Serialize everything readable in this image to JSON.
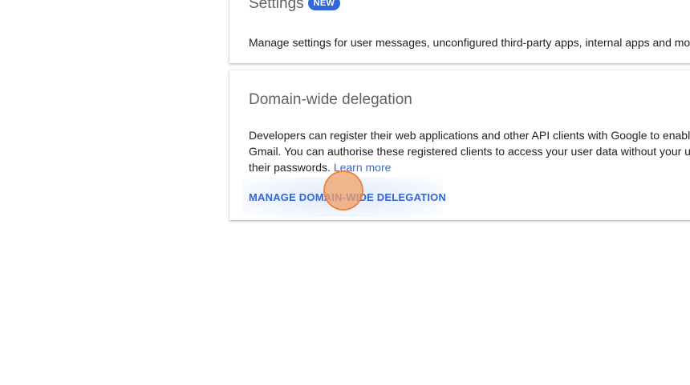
{
  "settings_card": {
    "title": "Settings",
    "badge": "NEW",
    "description": "Manage settings for user messages, unconfigured third-party apps, internal apps and mo"
  },
  "delegation_card": {
    "title": "Domain-wide delegation",
    "description_lines": [
      "Developers can register their web applications and other API clients with Google to enabl",
      "Gmail. You can authorise these registered clients to access your user data without your u",
      "their passwords. "
    ],
    "learn_more": "Learn more",
    "action_label": "MANAGE DOMAIN-WIDE DELEGATION"
  },
  "colors": {
    "accent": "#3367d6",
    "title_gray": "#5f6368",
    "click_marker": "#f0a064"
  }
}
